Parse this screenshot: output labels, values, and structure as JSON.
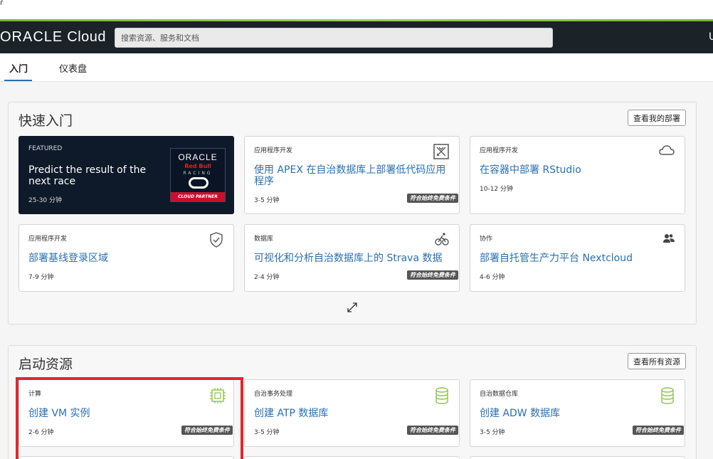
{
  "top": {
    "corner_mark": "ř"
  },
  "header": {
    "brand": "ORACLE",
    "product": "Cloud",
    "search_placeholder": "搜索资源、服务和文档",
    "right_glyph": "U"
  },
  "tabs": [
    {
      "label": "入门",
      "active": true
    },
    {
      "label": "仪表盘",
      "active": false
    }
  ],
  "quickstart": {
    "title": "快速入门",
    "button": "查看我的部署",
    "cards": [
      {
        "category": "FEATURED",
        "title": "Predict the result of the next race",
        "duration": "25-30 分钟",
        "featured": true,
        "logo": {
          "brand": "ORACLE",
          "team": "Red Bull",
          "racing": "RACING",
          "partner": "CLOUD PARTNER"
        }
      },
      {
        "category": "应用程序开发",
        "title": "使用 APEX 在自治数据库上部署低代码应用程序",
        "duration": "3-5 分钟",
        "free_tier": "符合始终免费条件",
        "icon": "apex-icon"
      },
      {
        "category": "应用程序开发",
        "title": "在容器中部署 RStudio",
        "duration": "10-12 分钟",
        "icon": "cloud-icon"
      },
      {
        "category": "应用程序开发",
        "title": "部署基线登录区域",
        "duration": "7-9 分钟",
        "icon": "shield-icon"
      },
      {
        "category": "数据库",
        "title": "可视化和分析自治数据库上的 Strava 数据",
        "duration": "2-4 分钟",
        "free_tier": "符合始终免费条件",
        "icon": "cycling-icon"
      },
      {
        "category": "协作",
        "title": "部署自托管生产力平台 Nextcloud",
        "duration": "4-6 分钟",
        "icon": "users-icon"
      }
    ]
  },
  "launch": {
    "title": "启动资源",
    "button": "查看所有资源",
    "cards": [
      {
        "category": "计算",
        "title": "创建 VM 实例",
        "duration": "2-6 分钟",
        "free_tier": "符合始终免费条件",
        "icon": "chip-icon"
      },
      {
        "category": "自治事务处理",
        "title": "创建 ATP 数据库",
        "duration": "3-5 分钟",
        "free_tier": "符合始终免费条件",
        "icon": "database-icon"
      },
      {
        "category": "自治数据仓库",
        "title": "创建 ADW 数据库",
        "duration": "3-5 分钟",
        "free_tier": "符合始终免费条件",
        "icon": "database-icon"
      }
    ]
  },
  "colors": {
    "accent": "#2a6fb0",
    "header_bg": "#1b2329",
    "highlight": "#e3262b",
    "featured_bg": "#0e1a2a"
  }
}
